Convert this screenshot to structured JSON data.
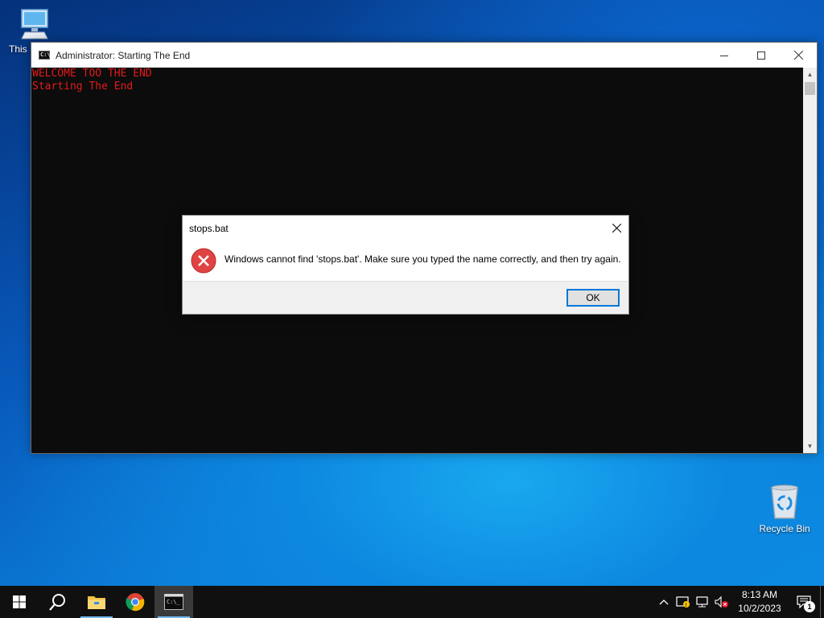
{
  "desktop": {
    "icons": [
      {
        "label": "This PC",
        "icon": "this-pc-icon"
      },
      {
        "label": "Recycle Bin",
        "icon": "recycle-bin-icon"
      }
    ]
  },
  "cmd_window": {
    "title": "Administrator:  Starting The End",
    "lines": [
      "WELCOME TOO THE END",
      "Starting The End"
    ],
    "text_color": "#e51a1a",
    "background": "#0c0c0c"
  },
  "dialog": {
    "title": "stops.bat",
    "message": "Windows cannot find 'stops.bat'. Make sure you typed the name correctly, and then try again.",
    "ok_label": "OK",
    "icon": "error-icon",
    "accent": "#0078d7"
  },
  "taskbar": {
    "pinned": [
      {
        "name": "start-button",
        "icon": "windows-logo-icon"
      },
      {
        "name": "search-button",
        "icon": "search-icon"
      },
      {
        "name": "file-explorer-button",
        "icon": "folder-icon"
      },
      {
        "name": "chrome-button",
        "icon": "chrome-icon"
      },
      {
        "name": "cmd-taskbar-button",
        "icon": "cmd-icon",
        "active": true
      }
    ],
    "tray_icons": [
      "chevron-up-icon",
      "security-warning-icon",
      "network-icon",
      "volume-muted-icon"
    ],
    "time": "8:13 AM",
    "date": "10/2/2023",
    "notification_count": "1"
  }
}
